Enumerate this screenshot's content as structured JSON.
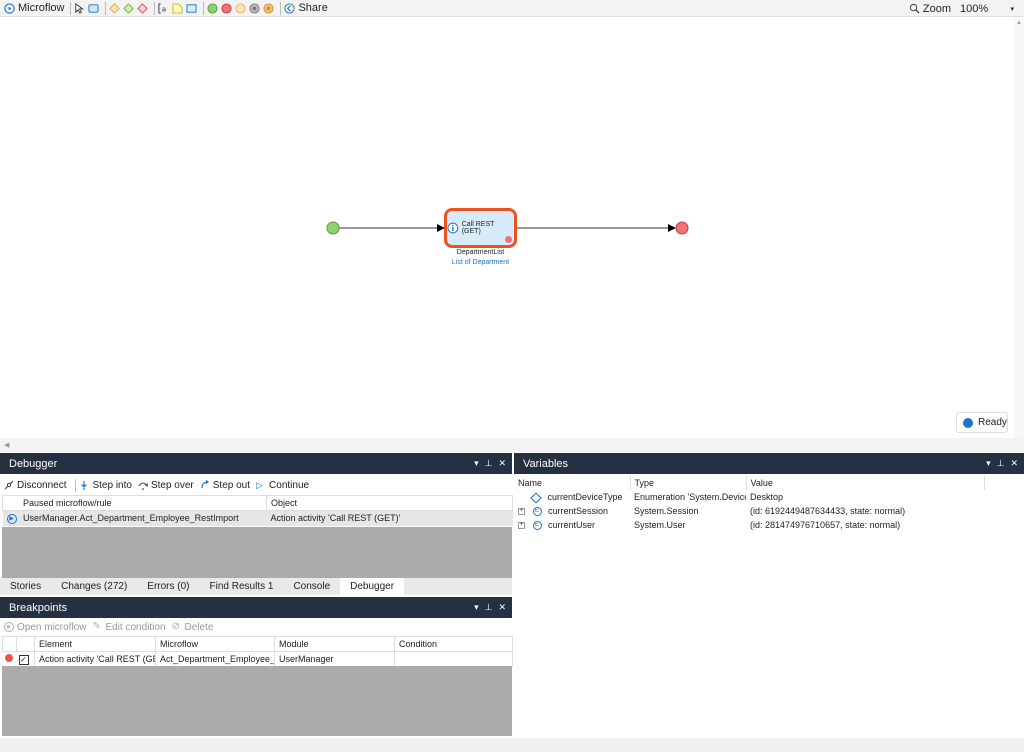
{
  "toolbar": {
    "title": "Microflow",
    "share_label": "Share",
    "zoom_label": "Zoom",
    "zoom_value": "100%"
  },
  "flow": {
    "activity_label": "Call REST (GET)",
    "output_variable": "DepartmentList",
    "output_type": "List of Department",
    "status": "Ready"
  },
  "debugger": {
    "title": "Debugger",
    "buttons": {
      "disconnect": "Disconnect",
      "step_into": "Step into",
      "step_over": "Step over",
      "step_out": "Step out",
      "continue": "Continue"
    },
    "columns": [
      "Paused microflow/rule",
      "Object"
    ],
    "rows": [
      {
        "microflow": "UserManager.Act_Department_Employee_RestImport",
        "object": "Action activity 'Call REST (GET)'"
      }
    ]
  },
  "bottom_tabs": [
    "Stories",
    "Changes (272)",
    "Errors (0)",
    "Find Results 1",
    "Console",
    "Debugger"
  ],
  "breakpoints": {
    "title": "Breakpoints",
    "buttons": {
      "open_microflow": "Open microflow",
      "edit_condition": "Edit condition",
      "delete": "Delete"
    },
    "columns": [
      "Element",
      "Microflow",
      "Module",
      "Condition"
    ],
    "rows": [
      {
        "element": "Action activity 'Call REST (GET)'",
        "microflow": "Act_Department_Employee_Re...",
        "module": "UserManager",
        "condition": ""
      }
    ]
  },
  "variables": {
    "title": "Variables",
    "columns": [
      "Name",
      "Type",
      "Value"
    ],
    "rows": [
      {
        "name": "currentDeviceType",
        "type": "Enumeration 'System.Device...",
        "value": "Desktop"
      },
      {
        "name": "currentSession",
        "type": "System.Session",
        "value": "(id: 6192449487634433, state: normal)"
      },
      {
        "name": "currentUser",
        "type": "System.User",
        "value": "(id: 281474976710657, state: normal)"
      }
    ]
  },
  "colors": {
    "panel_header": "#263043",
    "start_event": "#8fd16a",
    "end_event": "#f2707a",
    "activity_border": "#e8541d",
    "link_blue": "#1b74c9"
  }
}
